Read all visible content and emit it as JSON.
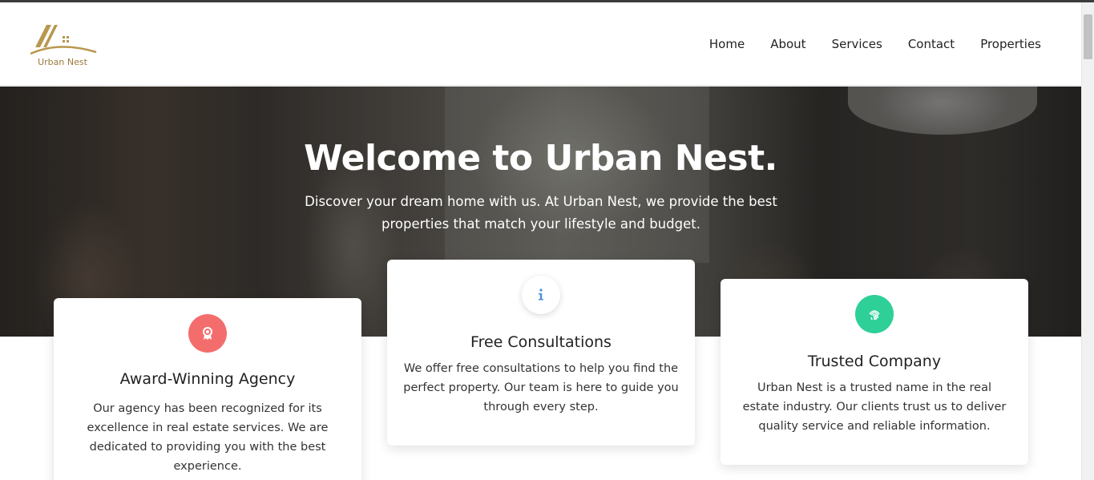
{
  "brand": {
    "name": "Urban Nest",
    "logo_color": "#b8974f"
  },
  "nav": {
    "items": [
      {
        "label": "Home"
      },
      {
        "label": "About"
      },
      {
        "label": "Services"
      },
      {
        "label": "Contact"
      },
      {
        "label": "Properties"
      }
    ]
  },
  "hero": {
    "title": "Welcome to Urban Nest.",
    "subtitle": "Discover your dream home with us. At Urban Nest, we provide the best properties that match your lifestyle and budget."
  },
  "features": [
    {
      "icon": "award-icon",
      "icon_bg": "#f46d6d",
      "title": "Award-Winning Agency",
      "text": "Our agency has been recognized for its excellence in real estate services. We are dedicated to providing you with the best experience."
    },
    {
      "icon": "info-icon",
      "icon_bg": "#ffffff",
      "title": "Free Consultations",
      "text": "We offer free consultations to help you find the perfect property. Our team is here to guide you through every step."
    },
    {
      "icon": "fingerprint-icon",
      "icon_bg": "#2fcf98",
      "title": "Trusted Company",
      "text": "Urban Nest is a trusted name in the real estate industry. Our clients trust us to deliver quality service and reliable information."
    }
  ]
}
